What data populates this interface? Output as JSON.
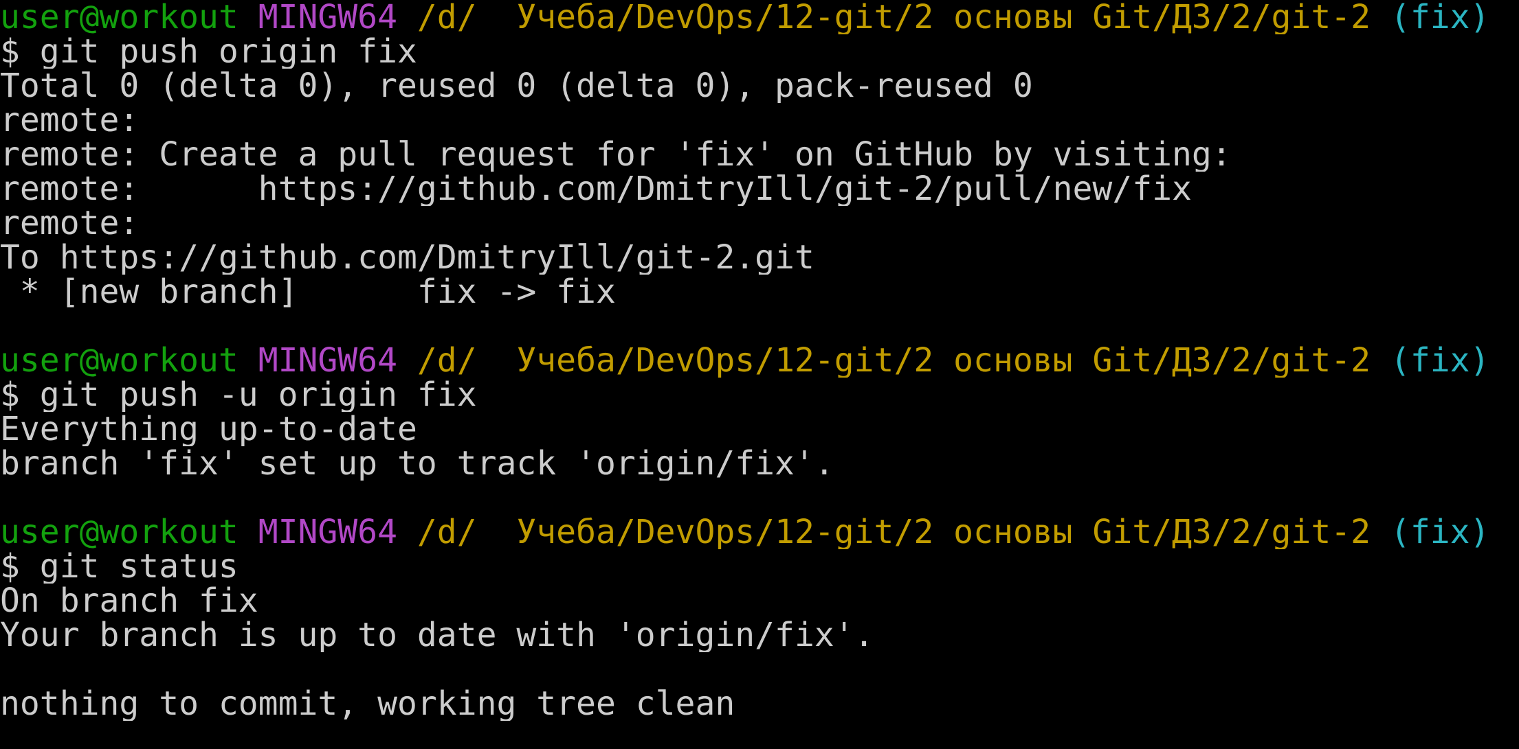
{
  "colors": {
    "background": "#000000",
    "text": "#cccccc",
    "user": "#13a10e",
    "host": "#b148c6",
    "path": "#c19c00",
    "branch": "#2bb5c2"
  },
  "prompt": {
    "user": "user@workout",
    "host": "MINGW64",
    "path": "/d/__Учеба/DevOps/12-git/2 основы Git/ДЗ/2/git-2",
    "branch": "(fix)"
  },
  "block1": {
    "command": "$ git push origin fix",
    "output": [
      "Total 0 (delta 0), reused 0 (delta 0), pack-reused 0",
      "remote:",
      "remote: Create a pull request for 'fix' on GitHub by visiting:",
      "remote:      https://github.com/DmitryIll/git-2/pull/new/fix",
      "remote:",
      "To https://github.com/DmitryIll/git-2.git",
      " * [new branch]      fix -> fix"
    ]
  },
  "block2": {
    "command": "$ git push -u origin fix",
    "output": [
      "Everything up-to-date",
      "branch 'fix' set up to track 'origin/fix'."
    ]
  },
  "block3": {
    "command": "$ git status",
    "output": [
      "On branch fix",
      "Your branch is up to date with 'origin/fix'.",
      "",
      "nothing to commit, working tree clean"
    ]
  }
}
